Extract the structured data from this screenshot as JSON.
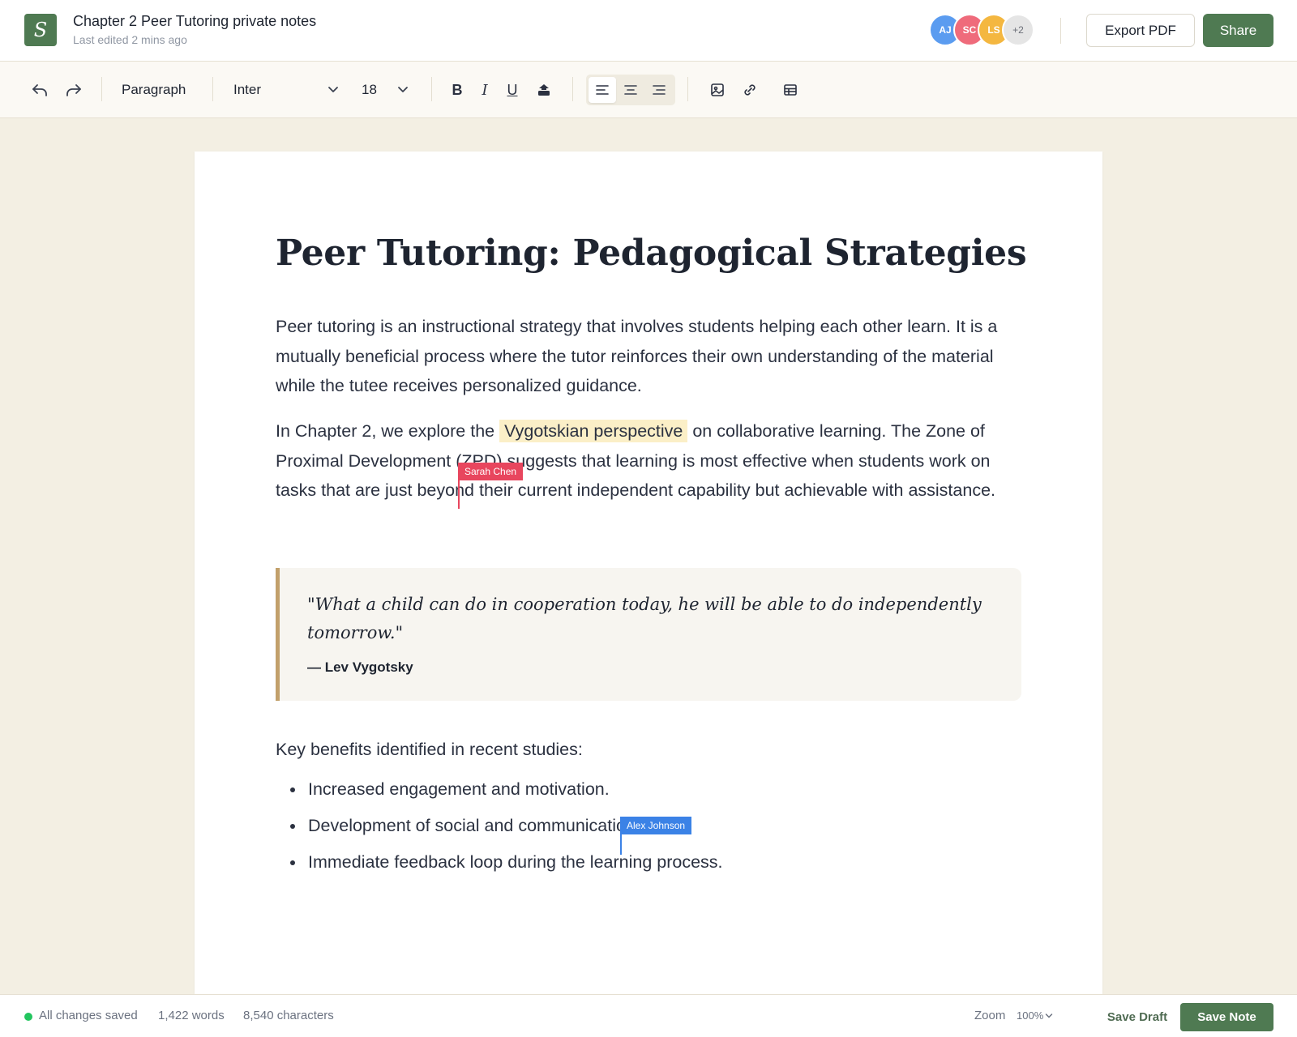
{
  "app": {
    "logo_letter": "S",
    "doc_title": "Chapter 2 Peer Tutoring private notes",
    "last_edited": "Last edited 2 mins ago",
    "collaborators": [
      {
        "initials": "AJ",
        "color": "#5b9cf0"
      },
      {
        "initials": "SC",
        "color": "#ef6b7b"
      },
      {
        "initials": "LS",
        "color": "#f4b740"
      }
    ],
    "more_collaborators": "+2",
    "export_label": "Export PDF",
    "share_label": "Share"
  },
  "toolbar": {
    "block_style": "Paragraph",
    "font_family": "Inter",
    "font_size": "18",
    "bold": "B",
    "italic": "I",
    "underline": "U",
    "active_alignment": "left"
  },
  "document": {
    "heading": "Peer Tutoring: Pedagogical Strategies",
    "paragraph1": "Peer tutoring is an instructional strategy that involves students helping each other learn. It is a mutually beneficial process where the tutor reinforces their own understanding of the material while the tutee receives personalized guidance.",
    "paragraph2_before": "In Chapter 2, we explore the ",
    "paragraph2_highlight": "Vygotskian perspective",
    "paragraph2_after": " on collaborative learning. The Zone of Proximal Development (ZPD) suggests that learning is most effective when students work on tasks that are just beyond their current independent capability but achievable with assistance.",
    "quote": "\"What a child can do in cooperation today, he will be able to do independently tomorrow.\"",
    "quote_author": "— Lev Vygotsky",
    "list_intro": "Key benefits identified in recent studies:",
    "benefits": [
      "Increased engagement and motivation.",
      "Development of social and communication skills.",
      "Immediate feedback loop during the learning process."
    ],
    "remote_cursors": [
      {
        "name": "Sarah Chen",
        "color": "#e8465e"
      },
      {
        "name": "Alex Johnson",
        "color": "#3b82e6"
      }
    ]
  },
  "footer": {
    "save_status": "All changes saved",
    "word_count": "1,422 words",
    "char_count": "8,540 characters",
    "zoom_label": "Zoom",
    "zoom_value": "100%",
    "save_draft_label": "Save Draft",
    "save_note_label": "Save Note"
  },
  "colors": {
    "brand": "#4f7a52",
    "highlight": "#fbefc7",
    "quote_border": "#c2a06b",
    "status_ok": "#22c55e"
  }
}
